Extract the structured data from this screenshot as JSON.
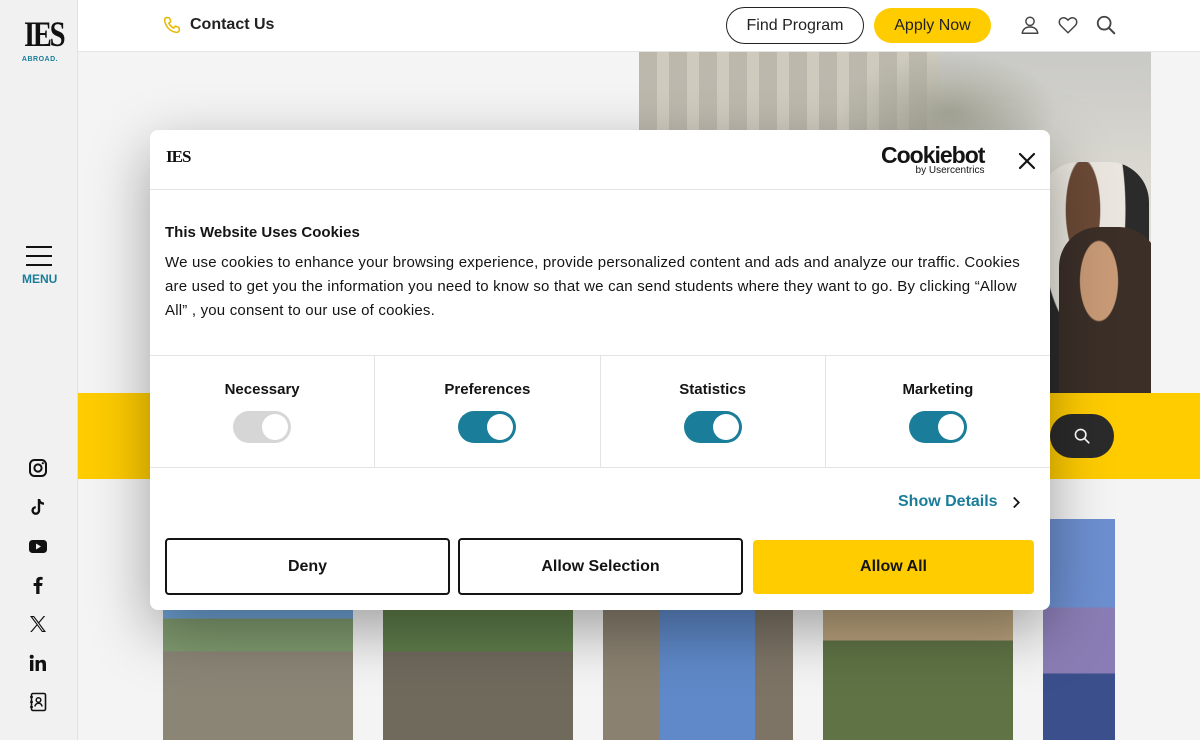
{
  "brand": {
    "logo_text": "IES",
    "logo_sub": "ABROAD."
  },
  "nav": {
    "menu_label": "MENU"
  },
  "header": {
    "contact_label": "Contact Us",
    "find_program_label": "Find Program",
    "apply_now_label": "Apply Now"
  },
  "social": [
    "instagram-icon",
    "tiktok-icon",
    "youtube-icon",
    "facebook-icon",
    "x-icon",
    "linkedin-icon",
    "contact-book-icon"
  ],
  "cookie_dialog": {
    "logo_text": "IES",
    "provider": "Cookiebot",
    "provider_sub": "by Usercentrics",
    "title": "This Website Uses Cookies",
    "body": "We use cookies to enhance your browsing experience, provide personalized content and ads and analyze our traffic.  Cookies are used to get you the information you need to know so that we can send students where they want to go.  By clicking  “Allow All” , you consent to our use of cookies.",
    "categories": [
      {
        "label": "Necessary",
        "enabled": true,
        "locked": true
      },
      {
        "label": "Preferences",
        "enabled": true,
        "locked": false
      },
      {
        "label": "Statistics",
        "enabled": true,
        "locked": false
      },
      {
        "label": "Marketing",
        "enabled": true,
        "locked": false
      }
    ],
    "show_details_label": "Show Details",
    "deny_label": "Deny",
    "allow_selection_label": "Allow Selection",
    "allow_all_label": "Allow All"
  },
  "colors": {
    "accent": "#1a7d9a",
    "brand_yellow": "#ffcc00",
    "text": "#141414"
  }
}
